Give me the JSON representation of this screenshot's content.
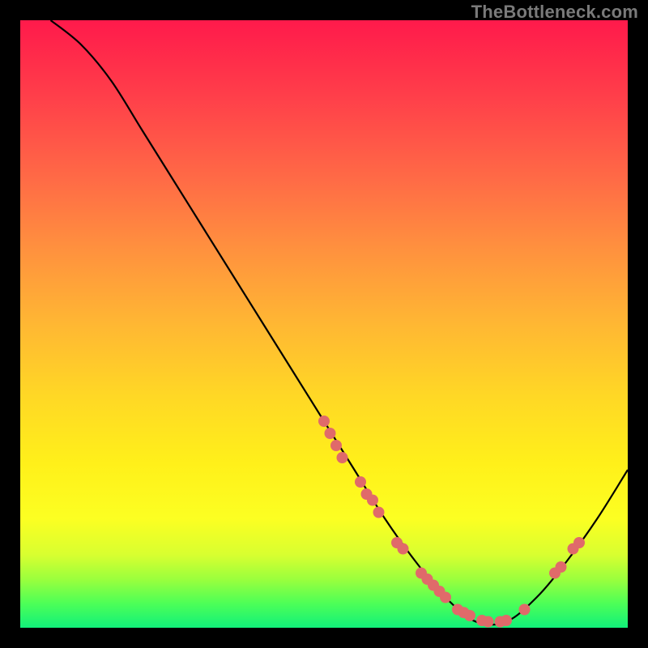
{
  "watermark": "TheBottleneck.com",
  "chart_data": {
    "type": "line",
    "title": "",
    "xlabel": "",
    "ylabel": "",
    "xlim": [
      0,
      100
    ],
    "ylim": [
      0,
      100
    ],
    "series": [
      {
        "name": "curve",
        "x": [
          5,
          10,
          15,
          20,
          25,
          30,
          35,
          40,
          45,
          50,
          55,
          60,
          65,
          70,
          75,
          80,
          85,
          90,
          95,
          100
        ],
        "y": [
          100,
          96,
          90,
          82,
          74,
          66,
          58,
          50,
          42,
          34,
          26,
          18,
          11,
          5,
          1,
          1,
          5,
          11,
          18,
          26
        ]
      }
    ],
    "markers": {
      "name": "highlight-points",
      "color": "#e06a6a",
      "radius": 7,
      "points_xy": [
        [
          50,
          34
        ],
        [
          51,
          32
        ],
        [
          52,
          30
        ],
        [
          53,
          28
        ],
        [
          56,
          24
        ],
        [
          57,
          22
        ],
        [
          58,
          21
        ],
        [
          59,
          19
        ],
        [
          62,
          14
        ],
        [
          63,
          13
        ],
        [
          66,
          9
        ],
        [
          67,
          8
        ],
        [
          68,
          7
        ],
        [
          69,
          6
        ],
        [
          70,
          5
        ],
        [
          72,
          3
        ],
        [
          73,
          2.5
        ],
        [
          74,
          2
        ],
        [
          76,
          1.2
        ],
        [
          77,
          1
        ],
        [
          79,
          1
        ],
        [
          80,
          1.2
        ],
        [
          83,
          3
        ],
        [
          88,
          9
        ],
        [
          89,
          10
        ],
        [
          91,
          13
        ],
        [
          92,
          14
        ]
      ]
    },
    "gradient_stops": [
      {
        "pos": 0,
        "color": "#ff1a4b"
      },
      {
        "pos": 12,
        "color": "#ff3d4a"
      },
      {
        "pos": 26,
        "color": "#ff6a46"
      },
      {
        "pos": 38,
        "color": "#ff923e"
      },
      {
        "pos": 50,
        "color": "#ffb733"
      },
      {
        "pos": 62,
        "color": "#ffd825"
      },
      {
        "pos": 73,
        "color": "#fff01a"
      },
      {
        "pos": 82,
        "color": "#fcff22"
      },
      {
        "pos": 88,
        "color": "#d8ff30"
      },
      {
        "pos": 92,
        "color": "#9bff3d"
      },
      {
        "pos": 96,
        "color": "#4dff57"
      },
      {
        "pos": 100,
        "color": "#11f07a"
      }
    ]
  }
}
